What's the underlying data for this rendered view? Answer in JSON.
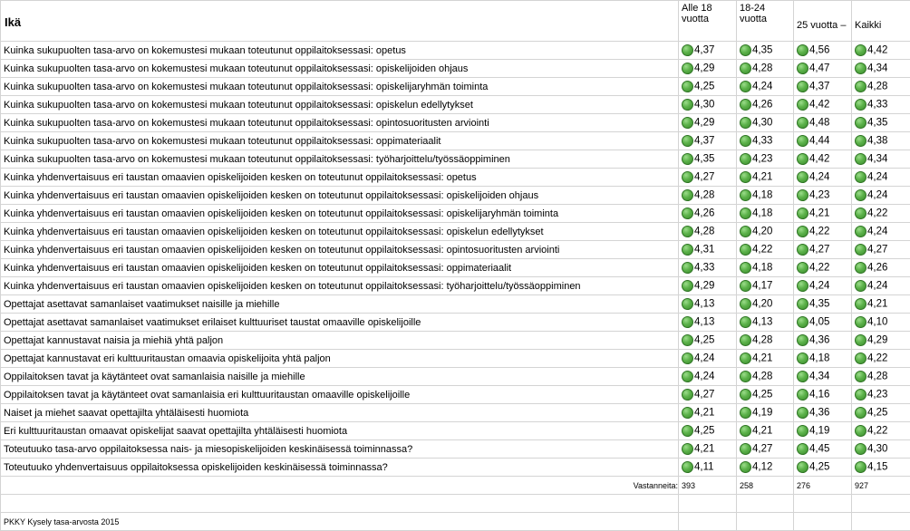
{
  "table": {
    "title": "Ikä",
    "columns": [
      {
        "line1": "Alle 18",
        "line2": "vuotta"
      },
      {
        "line1": "18-24",
        "line2": "vuotta"
      },
      {
        "line1": "",
        "line2": "25 vuotta –"
      },
      {
        "line1": "",
        "line2": "Kaikki"
      }
    ],
    "rows": [
      {
        "question": "Kuinka sukupuolten tasa-arvo on kokemustesi mukaan toteutunut oppilaitoksessasi: opetus",
        "values": [
          "4,37",
          "4,35",
          "4,56",
          "4,42"
        ]
      },
      {
        "question": "Kuinka sukupuolten tasa-arvo on kokemustesi mukaan toteutunut oppilaitoksessasi: opiskelijoiden ohjaus",
        "values": [
          "4,29",
          "4,28",
          "4,47",
          "4,34"
        ]
      },
      {
        "question": "Kuinka sukupuolten tasa-arvo on kokemustesi mukaan toteutunut oppilaitoksessasi: opiskelijaryhmän toiminta",
        "values": [
          "4,25",
          "4,24",
          "4,37",
          "4,28"
        ]
      },
      {
        "question": "Kuinka sukupuolten tasa-arvo on kokemustesi mukaan toteutunut oppilaitoksessasi: opiskelun edellytykset",
        "values": [
          "4,30",
          "4,26",
          "4,42",
          "4,33"
        ]
      },
      {
        "question": "Kuinka sukupuolten tasa-arvo on kokemustesi mukaan toteutunut oppilaitoksessasi: opintosuoritusten arviointi",
        "values": [
          "4,29",
          "4,30",
          "4,48",
          "4,35"
        ]
      },
      {
        "question": "Kuinka sukupuolten tasa-arvo on kokemustesi mukaan toteutunut oppilaitoksessasi: oppimateriaalit",
        "values": [
          "4,37",
          "4,33",
          "4,44",
          "4,38"
        ]
      },
      {
        "question": "Kuinka sukupuolten tasa-arvo on kokemustesi mukaan toteutunut oppilaitoksessasi: työharjoittelu/työssäoppiminen",
        "values": [
          "4,35",
          "4,23",
          "4,42",
          "4,34"
        ]
      },
      {
        "question": "Kuinka yhdenvertaisuus eri taustan omaavien opiskelijoiden kesken on toteutunut oppilaitoksessasi: opetus",
        "values": [
          "4,27",
          "4,21",
          "4,24",
          "4,24"
        ]
      },
      {
        "question": "Kuinka yhdenvertaisuus eri taustan omaavien opiskelijoiden kesken on toteutunut oppilaitoksessasi: opiskelijoiden ohjaus",
        "values": [
          "4,28",
          "4,18",
          "4,23",
          "4,24"
        ]
      },
      {
        "question": "Kuinka yhdenvertaisuus eri taustan omaavien opiskelijoiden kesken on toteutunut oppilaitoksessasi: opiskelijaryhmän toiminta",
        "values": [
          "4,26",
          "4,18",
          "4,21",
          "4,22"
        ]
      },
      {
        "question": "Kuinka yhdenvertaisuus eri taustan omaavien opiskelijoiden kesken on toteutunut oppilaitoksessasi: opiskelun edellytykset",
        "values": [
          "4,28",
          "4,20",
          "4,22",
          "4,24"
        ]
      },
      {
        "question": "Kuinka yhdenvertaisuus eri taustan omaavien opiskelijoiden kesken on toteutunut oppilaitoksessasi: opintosuoritusten arviointi",
        "values": [
          "4,31",
          "4,22",
          "4,27",
          "4,27"
        ]
      },
      {
        "question": "Kuinka yhdenvertaisuus eri taustan omaavien opiskelijoiden kesken on toteutunut oppilaitoksessasi: oppimateriaalit",
        "values": [
          "4,33",
          "4,18",
          "4,22",
          "4,26"
        ]
      },
      {
        "question": "Kuinka yhdenvertaisuus eri taustan omaavien opiskelijoiden kesken on toteutunut oppilaitoksessasi: työharjoittelu/työssäoppiminen",
        "values": [
          "4,29",
          "4,17",
          "4,24",
          "4,24"
        ]
      },
      {
        "question": "Opettajat asettavat samanlaiset vaatimukset naisille ja miehille",
        "values": [
          "4,13",
          "4,20",
          "4,35",
          "4,21"
        ]
      },
      {
        "question": "Opettajat asettavat samanlaiset vaatimukset erilaiset kulttuuriset taustat omaaville opiskelijoille",
        "values": [
          "4,13",
          "4,13",
          "4,05",
          "4,10"
        ]
      },
      {
        "question": "Opettajat kannustavat naisia ja miehiä yhtä paljon",
        "values": [
          "4,25",
          "4,28",
          "4,36",
          "4,29"
        ]
      },
      {
        "question": "Opettajat kannustavat eri kulttuuritaustan omaavia opiskelijoita yhtä paljon",
        "values": [
          "4,24",
          "4,21",
          "4,18",
          "4,22"
        ]
      },
      {
        "question": "Oppilaitoksen tavat ja käytänteet ovat samanlaisia naisille ja miehille",
        "values": [
          "4,24",
          "4,28",
          "4,34",
          "4,28"
        ]
      },
      {
        "question": "Oppilaitoksen tavat ja käytänteet ovat samanlaisia eri kulttuuritaustan omaaville opiskelijoille",
        "values": [
          "4,27",
          "4,25",
          "4,16",
          "4,23"
        ]
      },
      {
        "question": "Naiset ja miehet saavat opettajilta yhtäläisesti huomiota",
        "values": [
          "4,21",
          "4,19",
          "4,36",
          "4,25"
        ]
      },
      {
        "question": "Eri kulttuuritaustan omaavat opiskelijat saavat opettajilta yhtäläisesti huomiota",
        "values": [
          "4,25",
          "4,21",
          "4,19",
          "4,22"
        ]
      },
      {
        "question": "Toteutuuko tasa-arvo oppilaitoksessa nais- ja miesopiskelijoiden keskinäisessä toiminnassa?",
        "values": [
          "4,21",
          "4,27",
          "4,45",
          "4,30"
        ]
      },
      {
        "question": "Toteutuuko yhdenvertaisuus oppilaitoksessa opiskelijoiden keskinäisessä toiminnassa?",
        "values": [
          "4,11",
          "4,12",
          "4,25",
          "4,15"
        ]
      }
    ],
    "respondents_label": "Vastanneita:",
    "respondents": [
      "393",
      "258",
      "276",
      "927"
    ]
  },
  "footer": "PKKY Kysely tasa-arvosta 2015",
  "colors": {
    "indicator": "#5cb24a",
    "gridline": "#d4d4d4"
  },
  "icons": {
    "indicator": "green-circle-icon"
  }
}
